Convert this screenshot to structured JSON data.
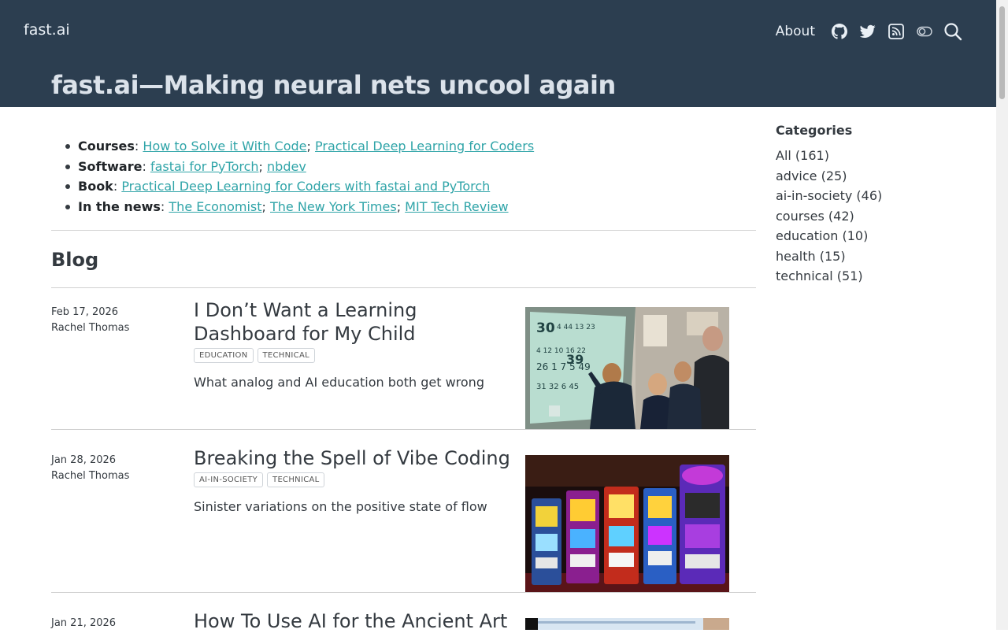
{
  "nav": {
    "brand": "fast.ai",
    "about": "About",
    "icons": [
      "github-icon",
      "twitter-icon",
      "rss-icon",
      "toggle-icon",
      "search-icon"
    ]
  },
  "site_title": "fast.ai—Making neural nets uncool again",
  "intro": {
    "courses_label": "Courses",
    "courses": [
      "How to Solve it With Code",
      "Practical Deep Learning for Coders"
    ],
    "software_label": "Software",
    "software": [
      "fastai for PyTorch",
      "nbdev"
    ],
    "book_label": "Book",
    "book": [
      "Practical Deep Learning for Coders with fastai and PyTorch"
    ],
    "news_label": "In the news",
    "news": [
      "The Economist",
      "The New York Times",
      "MIT Tech Review"
    ],
    "colon": ":",
    "sep": ";"
  },
  "blog_heading": "Blog",
  "posts": [
    {
      "date": "Feb 17, 2026",
      "author": "Rachel Thomas",
      "title": "I Don’t Want a Learning Dashboard for My Child",
      "tags": [
        "EDUCATION",
        "TECHNICAL"
      ],
      "description": "What analog and AI education both get wrong"
    },
    {
      "date": "Jan 28, 2026",
      "author": "Rachel Thomas",
      "title": "Breaking the Spell of Vibe Coding",
      "tags": [
        "AI-IN-SOCIETY",
        "TECHNICAL"
      ],
      "description": "Sinister variations on the positive state of flow"
    },
    {
      "date": "Jan 21, 2026",
      "author": "",
      "title": "How To Use AI for the Ancient Art",
      "tags": [],
      "description": ""
    }
  ],
  "categories": {
    "heading": "Categories",
    "items": [
      "All (161)",
      "advice (25)",
      "ai-in-society (46)",
      "courses (42)",
      "education (10)",
      "health (15)",
      "technical (51)"
    ]
  },
  "colors": {
    "navbar": "#2c3e50",
    "link": "#2fa4a8",
    "text": "#343a40"
  }
}
